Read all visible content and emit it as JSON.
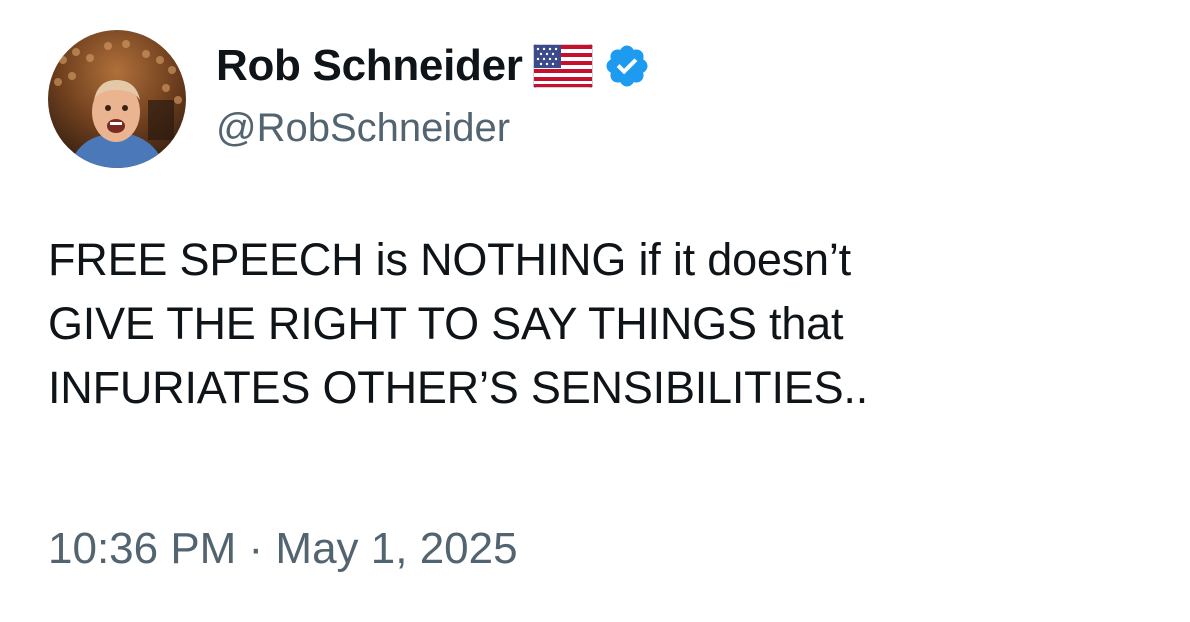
{
  "author": {
    "display_name": "Rob Schneider",
    "handle": "@RobSchneider",
    "avatar_icon": "profile-photo",
    "flag_icon": "us-flag-emoji",
    "verified_icon": "verified-badge",
    "verified_color": "#1d9bf0"
  },
  "tweet": {
    "lines": [
      "FREE SPEECH is NOTHING if it doesn’t",
      "GIVE THE RIGHT TO SAY THINGS that",
      "INFURIATES OTHER’S SENSIBILITIES.."
    ]
  },
  "meta": {
    "timestamp": "10:36 PM · May 1, 2025"
  },
  "colors": {
    "text_primary": "#0f1419",
    "text_secondary": "#536471",
    "background": "#ffffff"
  }
}
